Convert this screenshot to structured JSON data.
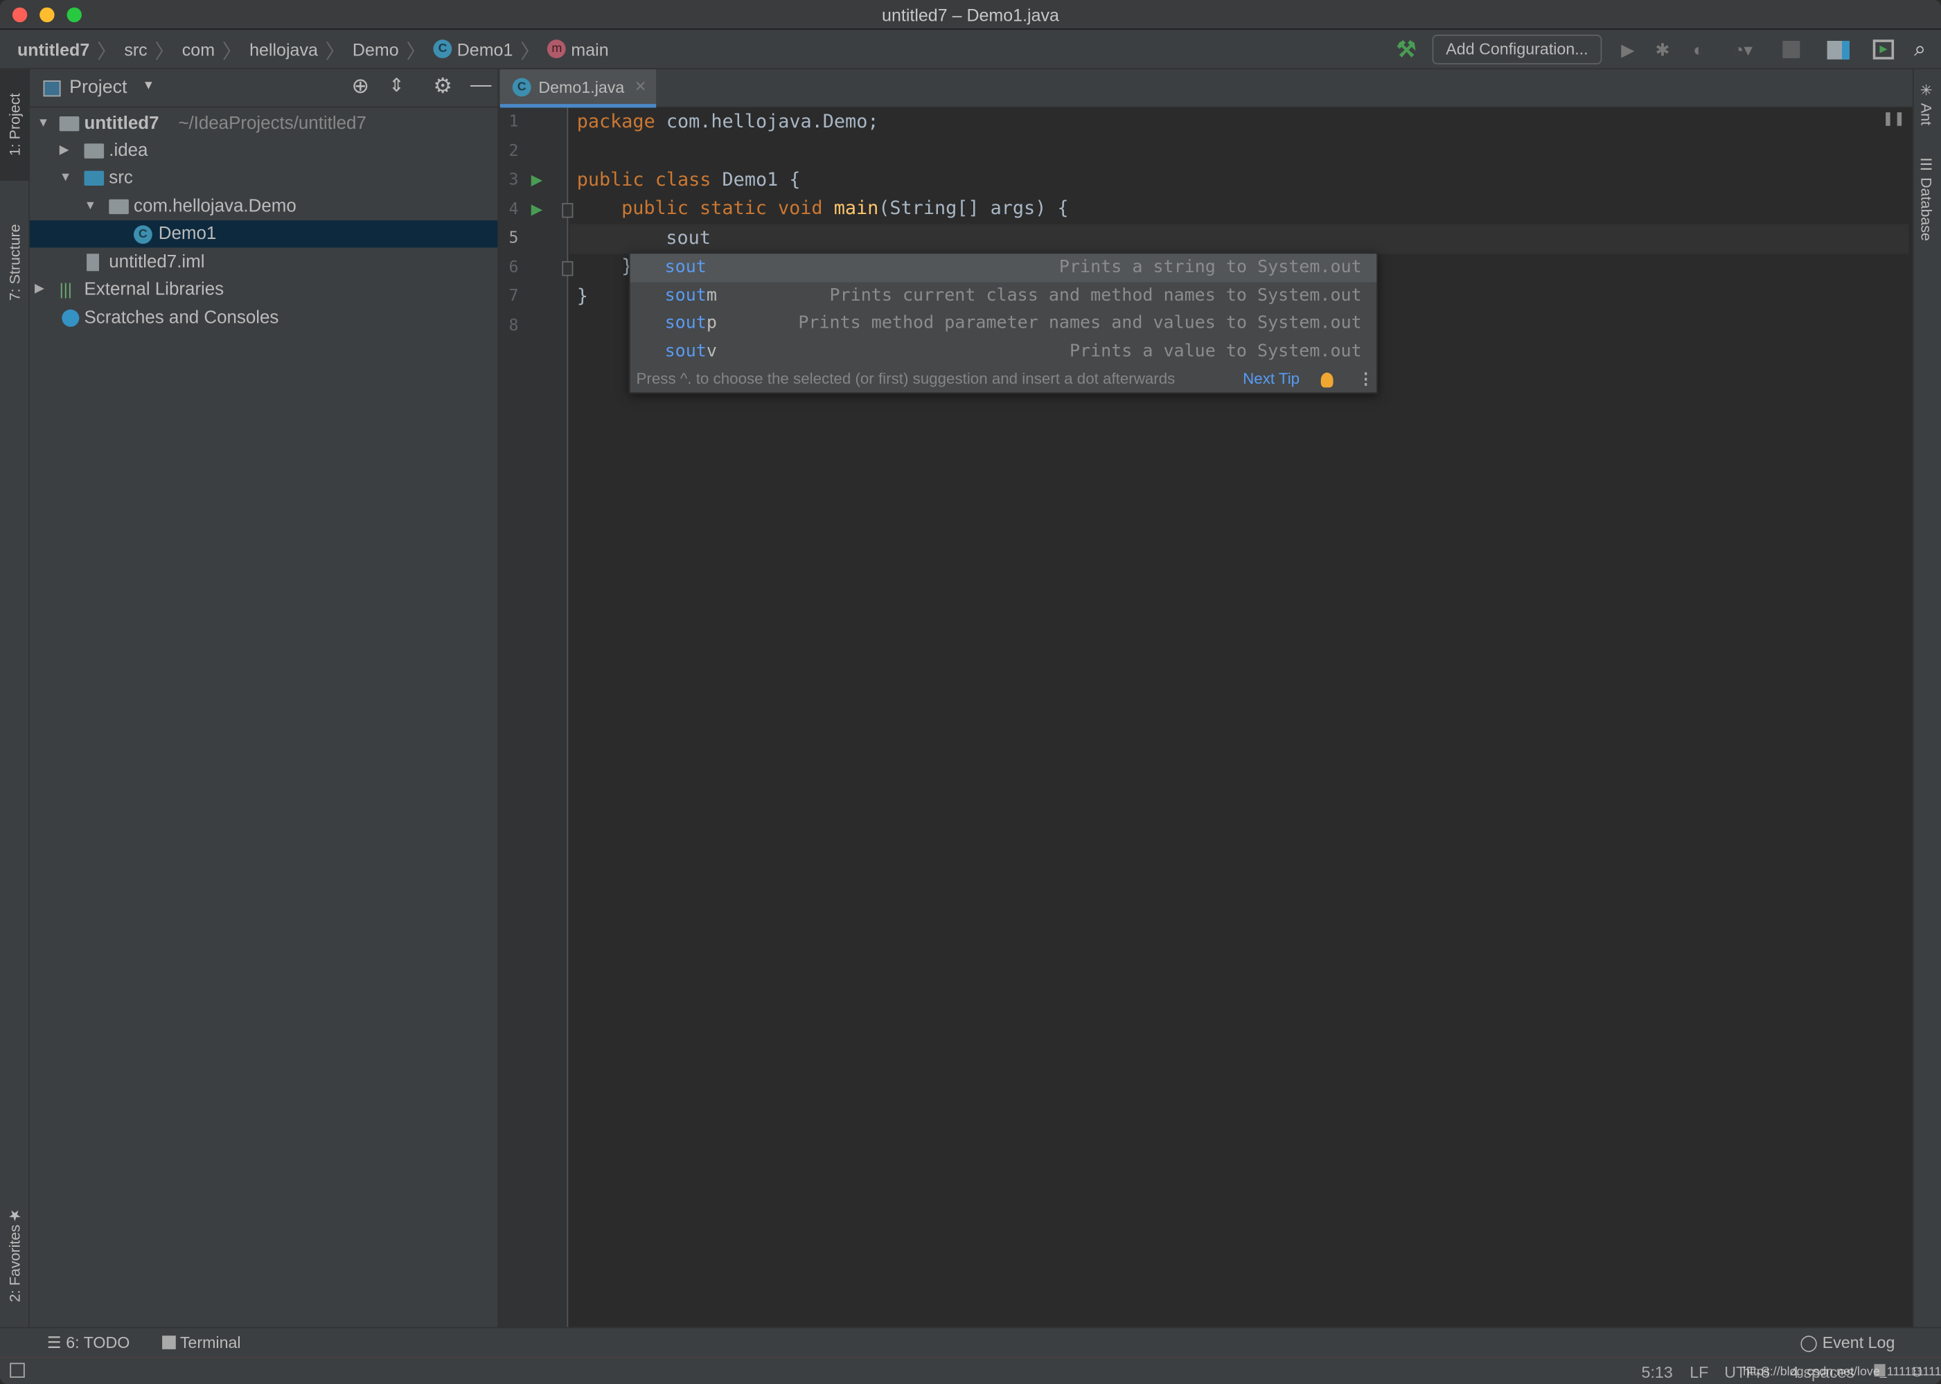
{
  "window": {
    "title": "untitled7 – Demo1.java"
  },
  "breadcrumb": [
    {
      "label": "untitled7"
    },
    {
      "label": "src"
    },
    {
      "label": "com"
    },
    {
      "label": "hellojava"
    },
    {
      "label": "Demo"
    },
    {
      "label": "Demo1",
      "icon": "class-icon"
    },
    {
      "label": "main",
      "icon": "method-icon"
    }
  ],
  "toolbar": {
    "add_configuration": "Add Configuration...",
    "icons": [
      "build-hammer-icon",
      "run-icon",
      "debug-icon",
      "coverage-icon",
      "profile-icon",
      "stop-icon",
      "project-structure-icon",
      "terminal-icon",
      "search-icon"
    ]
  },
  "left_strip": {
    "project": "1: Project",
    "structure": "7: Structure",
    "favorites": "2: Favorites"
  },
  "right_strip": {
    "ant": "Ant",
    "database": "Database"
  },
  "project_panel": {
    "title": "Project",
    "tree": [
      {
        "label": "untitled7",
        "path": "~/IdeaProjects/untitled7",
        "expanded": true,
        "icon": "module-folder-icon"
      },
      {
        "label": ".idea",
        "expanded": false,
        "icon": "folder-icon"
      },
      {
        "label": "src",
        "expanded": true,
        "icon": "source-folder-icon"
      },
      {
        "label": "com.hellojava.Demo",
        "expanded": true,
        "icon": "package-icon"
      },
      {
        "label": "Demo1",
        "selected": true,
        "icon": "class-icon"
      },
      {
        "label": "untitled7.iml",
        "icon": "iml-file-icon"
      },
      {
        "label": "External Libraries",
        "expanded": false,
        "icon": "libraries-icon"
      },
      {
        "label": "Scratches and Consoles",
        "icon": "scratches-icon"
      }
    ]
  },
  "editor": {
    "tab": "Demo1.java",
    "line_numbers": [
      "1",
      "2",
      "3",
      "4",
      "5",
      "6",
      "7",
      "8"
    ],
    "lines": {
      "l1": {
        "kw": "package",
        "rest": " com.hellojava.Demo;"
      },
      "l3": {
        "kw": "public class",
        "rest": " Demo1 {"
      },
      "l4": {
        "kw": "public static void",
        "fn": "main",
        "rest": "(String[] args) {"
      },
      "l5": {
        "rest": "sout"
      },
      "l6": {
        "rest": "}"
      },
      "l7": {
        "rest": "}"
      }
    },
    "current_line": "5"
  },
  "completion": {
    "prefix": "sout",
    "items": [
      {
        "suffix": "",
        "desc": "Prints a string to System.out",
        "selected": true
      },
      {
        "suffix": "m",
        "desc": "Prints current class and method names to System.out"
      },
      {
        "suffix": "p",
        "desc": "Prints method parameter names and values to System.out"
      },
      {
        "suffix": "v",
        "desc": "Prints a value to System.out"
      }
    ],
    "footer": "Press ^. to choose the selected (or first) suggestion and insert a dot afterwards",
    "next_tip": "Next Tip"
  },
  "bottom_bar": {
    "todo": "6: TODO",
    "terminal": "Terminal",
    "event_log": "Event Log"
  },
  "status_bar": {
    "position": "5:13",
    "line_sep": "LF",
    "encoding": "UTF-8",
    "indent": "4 spaces"
  },
  "watermark": "https://blog.csdn.net/love_111111111",
  "colors": {
    "accent": "#4a88c7",
    "keyword": "#cc7832",
    "function": "#ffc66d",
    "completion_match": "#5b9bf0",
    "selection": "#0d293e"
  }
}
